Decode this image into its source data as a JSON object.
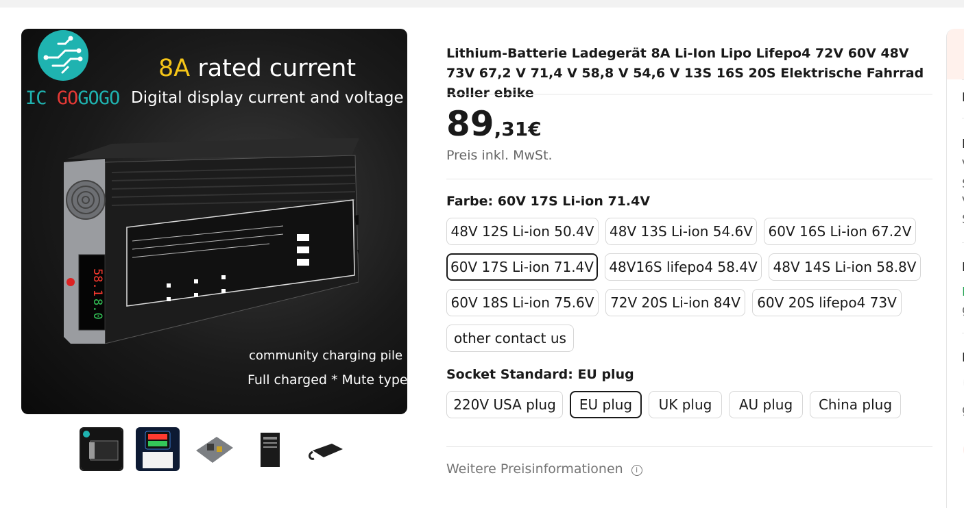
{
  "image": {
    "logo_text_ic": "IC ",
    "logo_text_go": "GO",
    "logo_text_gogo": "GOGO",
    "headline_accent": "8A",
    "headline_rest": " rated current",
    "subheadline": "Digital display current and voltage",
    "caption1": "community charging pile",
    "caption2": "Full charged * Mute type",
    "display_top": "58.1",
    "display_bottom": "8.0"
  },
  "product": {
    "title": "Lithium-Batterie Ladegerät 8A Li-Ion Lipo Lifepo4 72V 60V 48V 73V 67,2 V 71,4 V 58,8 V 54,6 V 13S 16S 20S Elektrische Fahrrad Roller ebike",
    "price_int": "89",
    "price_frac": ",31€",
    "tax_note": "Preis inkl. MwSt."
  },
  "color_option": {
    "label": "Farbe: ",
    "selected": "60V 17S Li-ion 71.4V",
    "items": [
      "48V 12S Li-ion 50.4V",
      "48V 13S Li-ion 54.6V",
      "60V 16S Li-ion 67.2V",
      "60V 17S Li-ion 71.4V",
      "48V16S lifepo4 58.4V",
      "48V 14S Li-ion 58.8V",
      "60V 18S Li-ion 75.6V",
      "72V 20S Li-ion 84V",
      "60V 20S lifepo4 73V",
      "other contact us"
    ]
  },
  "socket_option": {
    "label": "Socket Standard: ",
    "selected": "EU plug",
    "items": [
      "220V USA plug",
      "EU plug",
      "UK plug",
      "AU plug",
      "China plug"
    ]
  },
  "more_info": "Weitere Preisinformationen",
  "info_icon": "i",
  "right_panel_chars": [
    "L",
    "F",
    "V",
    "S",
    "V",
    "S",
    "F",
    "F",
    "g",
    "N",
    "g"
  ],
  "colors": {
    "accent_logo": "#1fb3b0",
    "headline_accent": "#f5c518",
    "selected_border": "#191919",
    "chip_border": "#d6d6d6"
  }
}
